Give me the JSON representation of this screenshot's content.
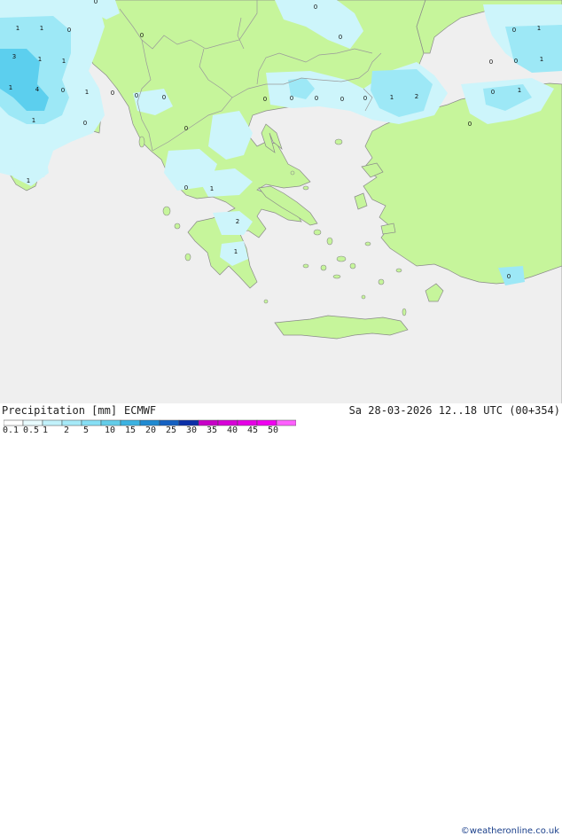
{
  "header": {
    "title": "Precipitation [mm]",
    "model": "ECMWF",
    "datetime": "Sa 28-03-2026 12..18 UTC (00+354)"
  },
  "credit": "©weatheronline.co.uk",
  "colors": {
    "sea": "#efefef",
    "land": "#c6f59b",
    "border": "#9a9a9a",
    "coast": "#8a8a8a",
    "precip_light": "#cdf5fb",
    "precip_mid": "#9de8f6",
    "precip_heavy": "#5ccfee"
  },
  "legend": {
    "ticks": [
      "0.1",
      "0.5",
      "1",
      "2",
      "5",
      "10",
      "15",
      "20",
      "25",
      "30",
      "35",
      "40",
      "45",
      "50"
    ],
    "colors": [
      "#ffffff",
      "#e8fbfe",
      "#c2f2fb",
      "#a6eaf8",
      "#86dff5",
      "#63cde9",
      "#3cb3e2",
      "#1f8ad1",
      "#1561c2",
      "#0b2fa8",
      "#c800c8",
      "#d800d8",
      "#e600e6",
      "#f000f0",
      "#ff60ff"
    ]
  },
  "values": [
    {
      "label": "1"
    },
    {
      "label": "1"
    },
    {
      "label": "0"
    },
    {
      "label": "0"
    },
    {
      "label": "0"
    },
    {
      "label": "0"
    },
    {
      "label": "0"
    },
    {
      "label": "3"
    },
    {
      "label": "1"
    },
    {
      "label": "1"
    },
    {
      "label": "1"
    },
    {
      "label": "4"
    },
    {
      "label": "0"
    },
    {
      "label": "1"
    },
    {
      "label": "0"
    },
    {
      "label": "0"
    },
    {
      "label": "0"
    },
    {
      "label": "1"
    },
    {
      "label": "0"
    },
    {
      "label": "1"
    },
    {
      "label": "0"
    },
    {
      "label": "0"
    },
    {
      "label": "0"
    },
    {
      "label": "0"
    },
    {
      "label": "0"
    },
    {
      "label": "1"
    },
    {
      "label": "2"
    },
    {
      "label": "0"
    },
    {
      "label": "0"
    },
    {
      "label": "1"
    },
    {
      "label": "0"
    },
    {
      "label": "1"
    },
    {
      "label": "0"
    },
    {
      "label": "0"
    },
    {
      "label": "1"
    },
    {
      "label": "0"
    },
    {
      "label": "0"
    },
    {
      "label": "1"
    },
    {
      "label": "2"
    },
    {
      "label": "1"
    },
    {
      "label": "0"
    }
  ]
}
